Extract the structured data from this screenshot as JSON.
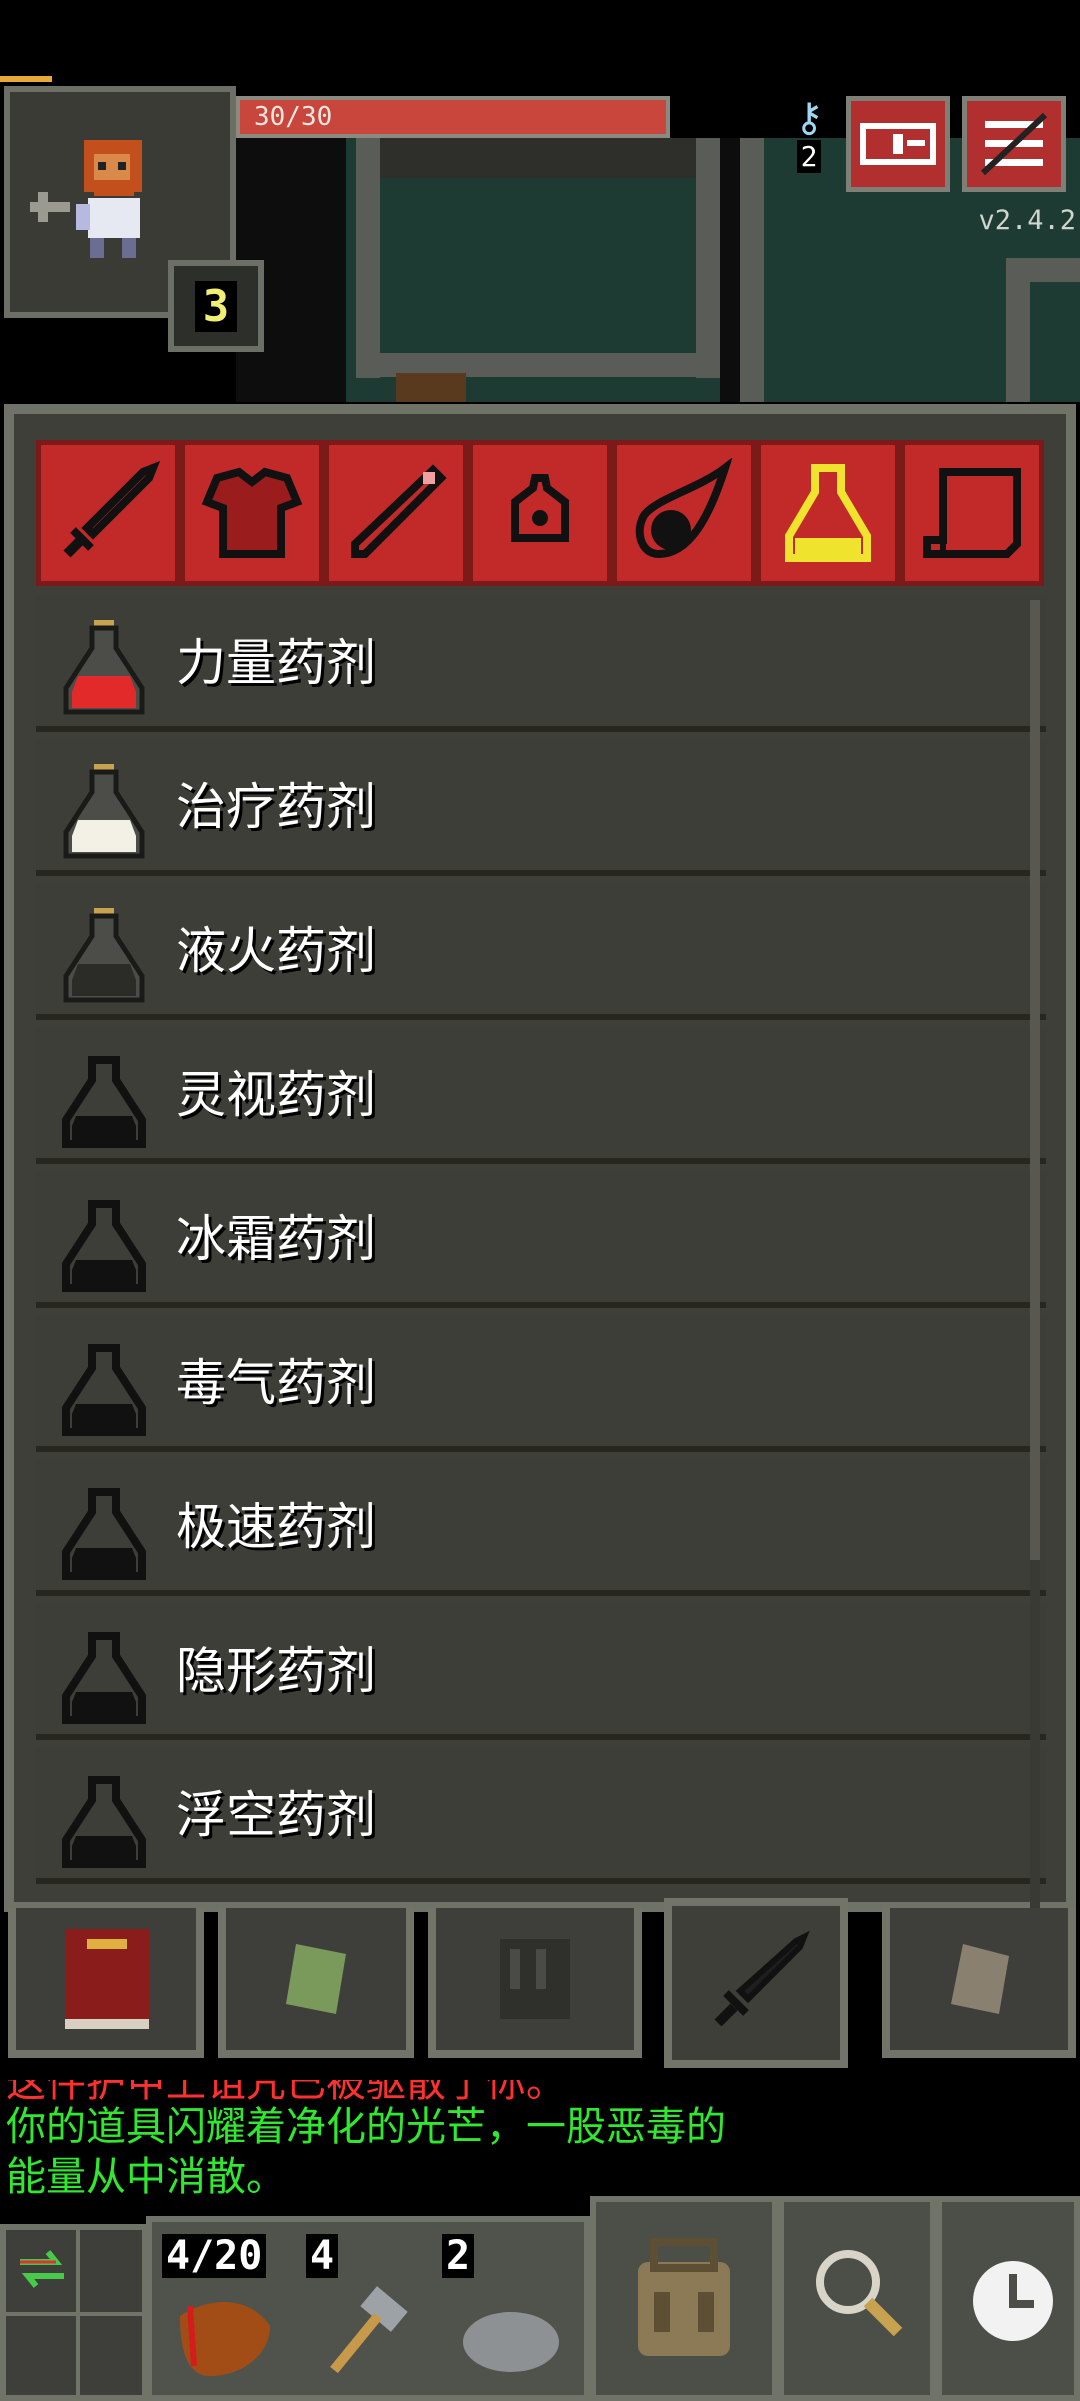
{
  "hud": {
    "hp_text": "30/30",
    "hp_fraction": 1.0,
    "level": "3",
    "keys_count": "2",
    "version": "v2.4.2",
    "journal_icon": "journal-icon",
    "menu_icon": "menu-icon"
  },
  "category_tabs": [
    {
      "name": "weapons",
      "icon": "sword-icon"
    },
    {
      "name": "armor",
      "icon": "armor-icon"
    },
    {
      "name": "wands",
      "icon": "wand-icon"
    },
    {
      "name": "rings",
      "icon": "ring-icon"
    },
    {
      "name": "artifacts",
      "icon": "artifact-icon"
    },
    {
      "name": "potions",
      "icon": "potion-icon",
      "selected": true
    },
    {
      "name": "scrolls",
      "icon": "scroll-icon"
    }
  ],
  "potions": [
    {
      "label": "力量药剂",
      "color": "#e22a2a",
      "known": true
    },
    {
      "label": "治疗药剂",
      "color": "#f3f0e6",
      "known": true
    },
    {
      "label": "液火药剂",
      "color": "#2b2b28",
      "known": true
    },
    {
      "label": "灵视药剂",
      "known": false
    },
    {
      "label": "冰霜药剂",
      "known": false
    },
    {
      "label": "毒气药剂",
      "known": false
    },
    {
      "label": "极速药剂",
      "known": false
    },
    {
      "label": "隐形药剂",
      "known": false
    },
    {
      "label": "浮空药剂",
      "known": false
    }
  ],
  "bottom_tabs": [
    {
      "name": "journal-book",
      "icon": "book-icon"
    },
    {
      "name": "notes",
      "icon": "note-icon"
    },
    {
      "name": "bestiary",
      "icon": "statue-icon"
    },
    {
      "name": "items",
      "icon": "sword-icon",
      "selected": true
    },
    {
      "name": "lore",
      "icon": "page-icon"
    }
  ],
  "log": {
    "line1": "这件护甲上诅咒已被驱散了你。",
    "line2": "你的道具闪耀着净化的光芒，一股恶毒的",
    "line3": "能量从中消散。"
  },
  "toolbar": {
    "slot1_label": "4/20",
    "slot2_label": "4",
    "slot3_label": "2"
  },
  "colors": {
    "panel_bg": "#3f3f39",
    "tab_red": "#c22a2a",
    "selected_tab_icon": "#f0e32e",
    "log_green": "#2fe82f"
  }
}
